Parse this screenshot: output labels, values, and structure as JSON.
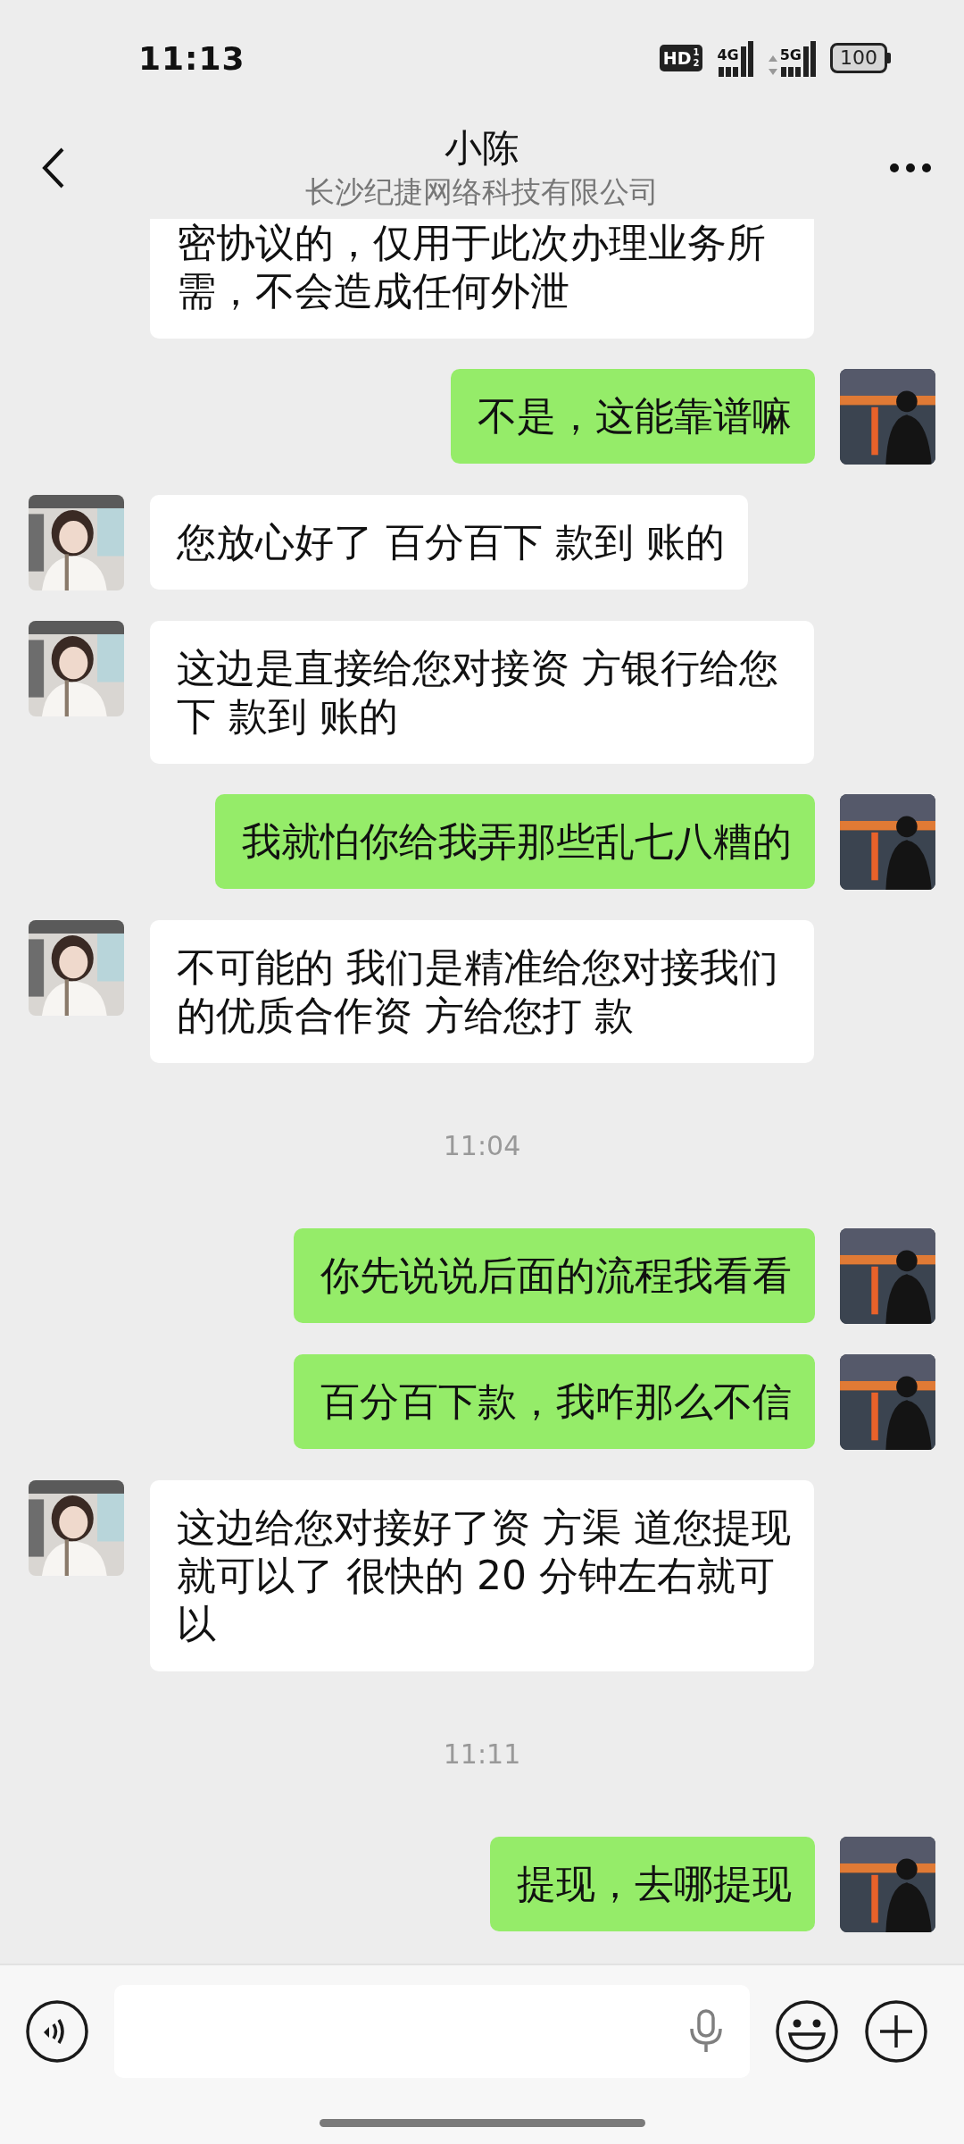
{
  "status_bar": {
    "time": "11:13",
    "hd": {
      "label": "HD",
      "sims": [
        "1",
        "2"
      ]
    },
    "signals": [
      {
        "label": "4G",
        "arrows": false
      },
      {
        "label": "5G",
        "arrows": true
      }
    ],
    "battery": "100"
  },
  "header": {
    "title": "小陈",
    "subtitle": "长沙纪捷网络科技有限公司"
  },
  "messages": [
    {
      "kind": "received",
      "text": "密协议的，仅用于此次办理业务所需，不会造成任何外泄",
      "clipped_top": true
    },
    {
      "kind": "sent",
      "text": "不是，这能靠谱嘛"
    },
    {
      "kind": "received",
      "text": "您放心好了 百分百下 款到 账的"
    },
    {
      "kind": "received",
      "text": "这边是直接给您对接资 方银行给您下 款到 账的"
    },
    {
      "kind": "sent",
      "text": "我就怕你给我弄那些乱七八糟的"
    },
    {
      "kind": "received",
      "text": "不可能的 我们是精准给您对接我们的优质合作资 方给您打 款"
    },
    {
      "kind": "time",
      "text": "11:04"
    },
    {
      "kind": "sent",
      "text": "你先说说后面的流程我看看"
    },
    {
      "kind": "sent",
      "text": "百分百下款，我咋那么不信"
    },
    {
      "kind": "received",
      "text": "这边给您对接好了资 方渠 道您提现就可以了 很快的 20 分钟左右就可以"
    },
    {
      "kind": "time",
      "text": "11:11"
    },
    {
      "kind": "sent",
      "text": "提现，去哪提现"
    }
  ]
}
